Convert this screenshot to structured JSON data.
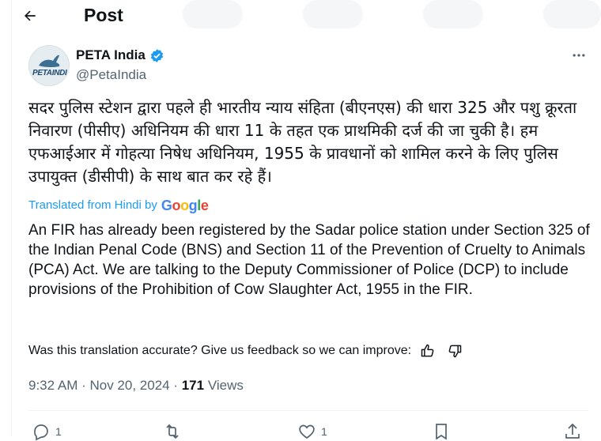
{
  "header": {
    "title": "Post"
  },
  "post": {
    "author_name": "PETA India",
    "handle": "@PetaIndia",
    "avatar_text": "PETAINDIA",
    "hindi_text": "सदर पुलिस स्टेशन द्वारा पहले ही भारतीय न्याय संहिता (बीएनएस) की धारा 325 और पशु क्रूरता निवारण (पीसीए) अधिनियम की धारा 11 के तहत एक प्राथमिकी दर्ज की जा चुकी है। हम एफआईआर में गोहत्या निषेध अधिनियम, 1955 के प्रावधानों को शामिल करने के लिए पुलिस उपायुक्त (डीसीपी) के साथ बात कर रहे हैं।",
    "translated_label": "Translated from Hindi by",
    "translator": "Google",
    "english_text": "An FIR has already been registered by the Sadar police station under Section 325 of the Indian Penal Code (BNS) and Section 11 of the Prevention of Cruelty to Animals (PCA) Act. We are talking to the Deputy Commissioner of Police (DCP) to include provisions of the Prohibition of Cow Slaughter Act, 1955 in the FIR.",
    "feedback_text": "Was this translation accurate? Give us feedback so we can improve:",
    "time": "9:32 AM · Nov 20, 2024 · ",
    "views_count": "171",
    "views_label": " Views"
  },
  "actions": {
    "reply_count": "1",
    "like_count": "1"
  },
  "colors": {
    "accent": "#1d9bf0",
    "muted": "#536471",
    "text": "#0f1419"
  },
  "icons": [
    "back-arrow-icon",
    "verified-badge-icon",
    "more-icon",
    "thumbs-up-icon",
    "thumbs-down-icon",
    "reply-icon",
    "repost-icon",
    "like-icon",
    "bookmark-icon",
    "share-icon"
  ]
}
